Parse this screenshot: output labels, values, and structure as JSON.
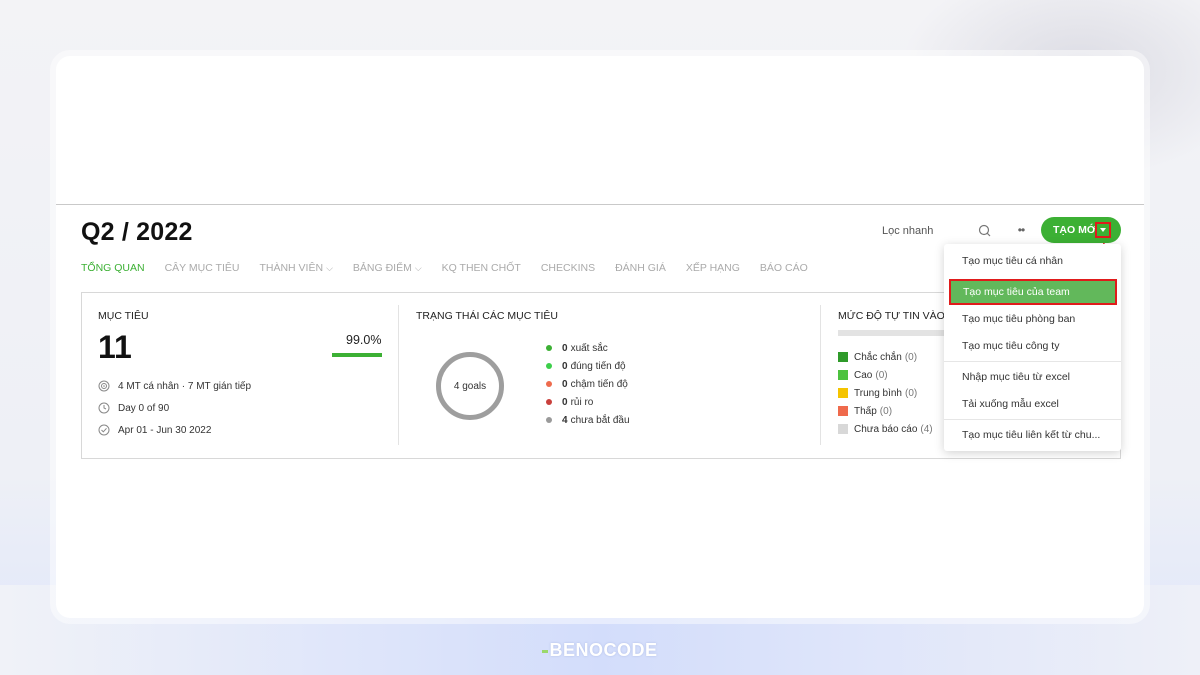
{
  "header": {
    "period": "Q2 / 2022",
    "filter_label": "Lọc nhanh",
    "more_label": "••",
    "create_label": "TẠO MỚI"
  },
  "tabs": [
    {
      "label": "TỔNG QUAN",
      "active": true
    },
    {
      "label": "CÂY MỤC TIÊU"
    },
    {
      "label": "THÀNH VIÊN",
      "has_dropdown": true
    },
    {
      "label": "BẢNG ĐIỂM",
      "has_dropdown": true
    },
    {
      "label": "KQ THEN CHỐT"
    },
    {
      "label": "CHECKINS"
    },
    {
      "label": "ĐÁNH GIÁ"
    },
    {
      "label": "XẾP HẠNG"
    },
    {
      "label": "BÁO CÁO"
    }
  ],
  "goals": {
    "title": "MỤC TIÊU",
    "count": "11",
    "percent": "99.0%",
    "percent_value": 0.99,
    "breakdown": "4 MT cá nhân · 7 MT gián tiếp",
    "day": "Day 0 of 90",
    "date_range": "Apr 01 - Jun 30 2022"
  },
  "status": {
    "title": "TRẠNG THÁI CÁC MỤC TIÊU",
    "donut_label": "4 goals",
    "items": [
      {
        "count": "0",
        "label": "xuất sắc",
        "color": "#3cb034"
      },
      {
        "count": "0",
        "label": "đúng tiến độ",
        "color": "#3ccf4a"
      },
      {
        "count": "0",
        "label": "chậm tiến độ",
        "color": "#ee6b4d"
      },
      {
        "count": "0",
        "label": "rủi ro",
        "color": "#c9403c"
      },
      {
        "count": "4",
        "label": "chưa bắt đầu",
        "color": "#9a9a9a"
      }
    ]
  },
  "confidence": {
    "title": "MỨC ĐỘ TỰ TIN VÀO M",
    "items": [
      {
        "label": "Chắc chắn",
        "count": "(0)",
        "color": "#2f9a2a"
      },
      {
        "label": "Cao",
        "count": "(0)",
        "color": "#4cc23f"
      },
      {
        "label": "Trung bình",
        "count": "(0)",
        "color": "#f5c400"
      },
      {
        "label": "Thấp",
        "count": "(0)",
        "color": "#ef6a4c"
      },
      {
        "label": "Chưa báo cáo",
        "count": "(4)",
        "color": "#d8d8d8"
      }
    ]
  },
  "menu": {
    "items": [
      {
        "label": "Tạo mục tiêu cá nhân"
      },
      {
        "label": "Tạo mục tiêu của team",
        "selected": true
      },
      {
        "label": "Tạo mục tiêu phòng ban"
      },
      {
        "label": "Tạo mục tiêu công ty"
      },
      {
        "label": "Nhập mục tiêu từ excel"
      },
      {
        "label": "Tải xuống mẫu excel"
      },
      {
        "label": "Tạo mục tiêu liên kết từ chu..."
      }
    ]
  },
  "brand": "BENOCODE",
  "colors": {
    "accent": "#3cb034",
    "highlight": "#e01b1b"
  }
}
